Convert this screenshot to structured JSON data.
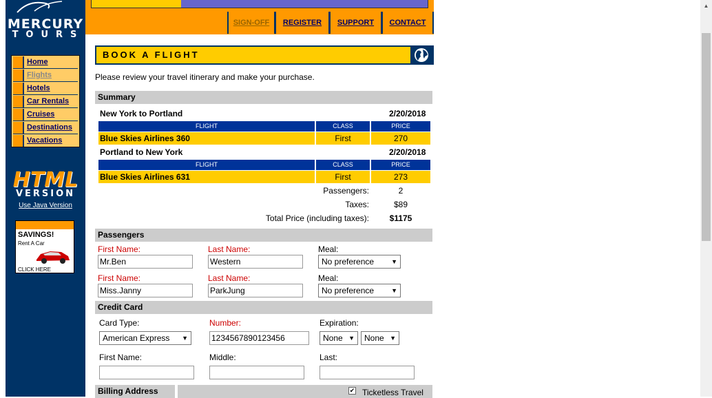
{
  "logo": {
    "line1": "MERCURY",
    "line2": "TOURS"
  },
  "nav": [
    {
      "label": "Home",
      "current": false
    },
    {
      "label": "Flights",
      "current": true
    },
    {
      "label": "Hotels",
      "current": false
    },
    {
      "label": "Car Rentals",
      "current": false
    },
    {
      "label": "Cruises",
      "current": false
    },
    {
      "label": "Destinations",
      "current": false
    },
    {
      "label": "Vacations",
      "current": false
    }
  ],
  "html_version": {
    "big": "HTML",
    "sub": "VERSION",
    "link": "Use Java Version"
  },
  "ad": {
    "title": "SAVINGS!",
    "sub": "Rent A Car",
    "cta": "CLICK HERE"
  },
  "toplinks": [
    "SIGN-OFF",
    "REGISTER",
    "SUPPORT",
    "CONTACT"
  ],
  "page_title": "BOOK A FLIGHT",
  "intro": "Please review your travel itinerary and make your purchase.",
  "summary": {
    "heading": "Summary",
    "legs": [
      {
        "route": "New York to Portland",
        "date": "2/20/2018",
        "flight": "Blue Skies Airlines 360",
        "class": "First",
        "price": "270"
      },
      {
        "route": "Portland to New York",
        "date": "2/20/2018",
        "flight": "Blue Skies Airlines 631",
        "class": "First",
        "price": "273"
      }
    ],
    "col_flight": "FLIGHT",
    "col_class": "CLASS",
    "col_price": "PRICE",
    "passengers_label": "Passengers:",
    "passengers": "2",
    "taxes_label": "Taxes:",
    "taxes": "$89",
    "total_label": "Total Price (including taxes):",
    "total": "$1175"
  },
  "passengers": {
    "heading": "Passengers",
    "first_label": "First Name:",
    "last_label": "Last Name:",
    "meal_label": "Meal:",
    "list": [
      {
        "first": "Mr.Ben",
        "last": "Western",
        "meal": "No preference"
      },
      {
        "first": "Miss.Janny",
        "last": "ParkJung",
        "meal": "No preference"
      }
    ]
  },
  "credit": {
    "heading": "Credit Card",
    "type_label": "Card Type:",
    "type": "American Express",
    "number_label": "Number:",
    "number": "1234567890123456",
    "exp_label": "Expiration:",
    "exp_month": "None",
    "exp_year": "None",
    "first_label": "First Name:",
    "middle_label": "Middle:",
    "last_label": "Last:"
  },
  "billing": {
    "heading": "Billing Address",
    "ticketless": "Ticketless Travel",
    "ticketless_checked": true
  },
  "colors": {
    "navy": "#003366",
    "orange": "#ff9900",
    "yellow": "#ffcc00",
    "blue_header": "#003399"
  }
}
